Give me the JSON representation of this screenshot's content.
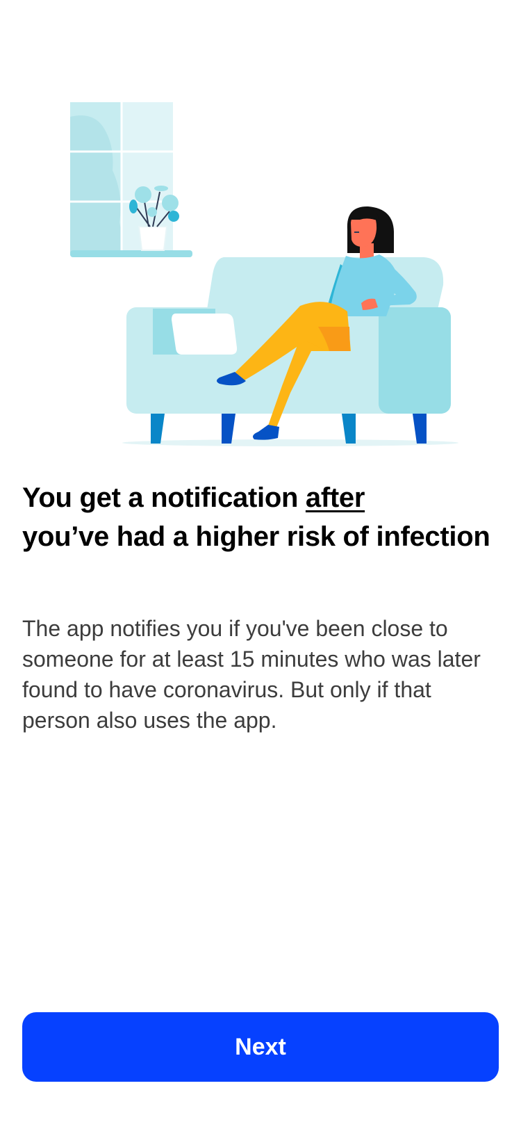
{
  "onboarding": {
    "illustration_name": "woman-relaxing-on-sofa-illustration",
    "title_part1": "You get a notification ",
    "title_emphasis": "after",
    "title_part2": "you’ve had a higher risk of infection",
    "body": "The app notifies you if you've been close to someone for at least 15 minutes who was later found to have coronavirus. But only if that person also uses the app.",
    "next_label": "Next"
  },
  "colors": {
    "primary": "#0641ff",
    "title": "#000000",
    "body": "#3c3c3c",
    "background": "#ffffff"
  }
}
